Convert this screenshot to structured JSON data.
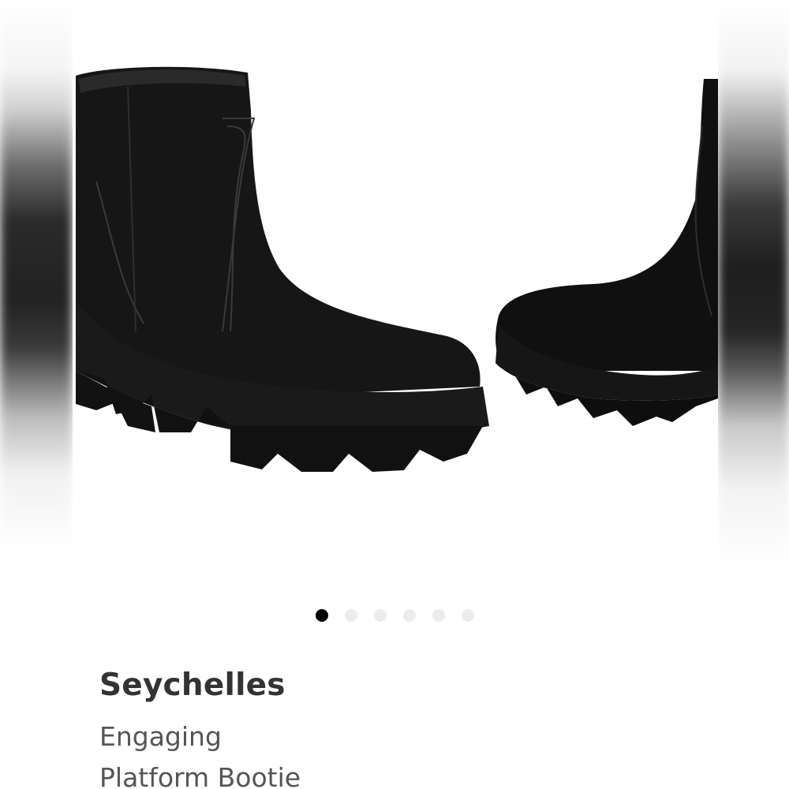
{
  "product": {
    "brand": "Seychelles",
    "name_line1": "Engaging",
    "name_line2": "Platform Bootie",
    "image": "black-suede-platform-ankle-boots"
  },
  "carousel": {
    "total": 6,
    "active_index": 0
  },
  "colors": {
    "boot": "#141414",
    "dot_active": "#000000",
    "dot_inactive": "#ececec",
    "brand_text": "#333333",
    "name_text": "#555555"
  }
}
